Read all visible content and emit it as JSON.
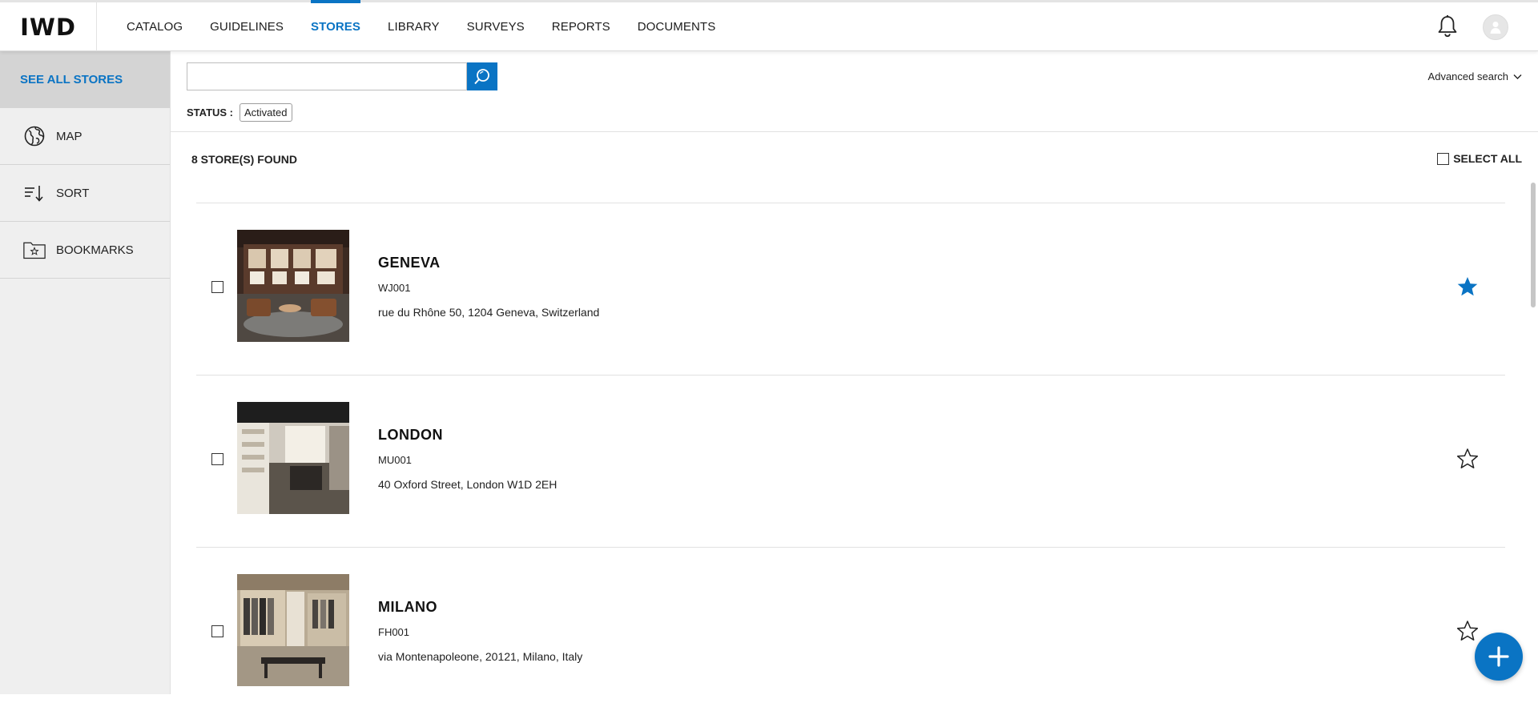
{
  "logo": "IWD",
  "nav": [
    {
      "label": "CATALOG"
    },
    {
      "label": "GUIDELINES"
    },
    {
      "label": "STORES",
      "active": true
    },
    {
      "label": "LIBRARY"
    },
    {
      "label": "SURVEYS"
    },
    {
      "label": "REPORTS"
    },
    {
      "label": "DOCUMENTS"
    }
  ],
  "sidebar": {
    "see_all": "SEE ALL STORES",
    "items": [
      {
        "label": "MAP",
        "icon": "globe-icon"
      },
      {
        "label": "SORT",
        "icon": "sort-icon"
      },
      {
        "label": "BOOKMARKS",
        "icon": "bookmark-folder-icon"
      }
    ]
  },
  "search": {
    "placeholder": "",
    "value": "",
    "advanced_label": "Advanced search"
  },
  "filters": {
    "status_label": "STATUS :",
    "status_value": "Activated"
  },
  "results": {
    "count_label": "8 STORE(S) FOUND",
    "select_all_label": "SELECT ALL"
  },
  "stores": [
    {
      "name": "GENEVA",
      "code": "WJ001",
      "address": "rue du Rhône 50, 1204 Geneva, Switzerland",
      "bookmarked": true
    },
    {
      "name": "LONDON",
      "code": "MU001",
      "address": "40 Oxford Street, London W1D 2EH",
      "bookmarked": false
    },
    {
      "name": "MILANO",
      "code": "FH001",
      "address": "via Montenapoleone, 20121, Milano, Italy",
      "bookmarked": false
    }
  ],
  "colors": {
    "accent": "#0a74c4",
    "sidebar_bg": "#efefef",
    "sidebar_active": "#d4d4d4"
  }
}
